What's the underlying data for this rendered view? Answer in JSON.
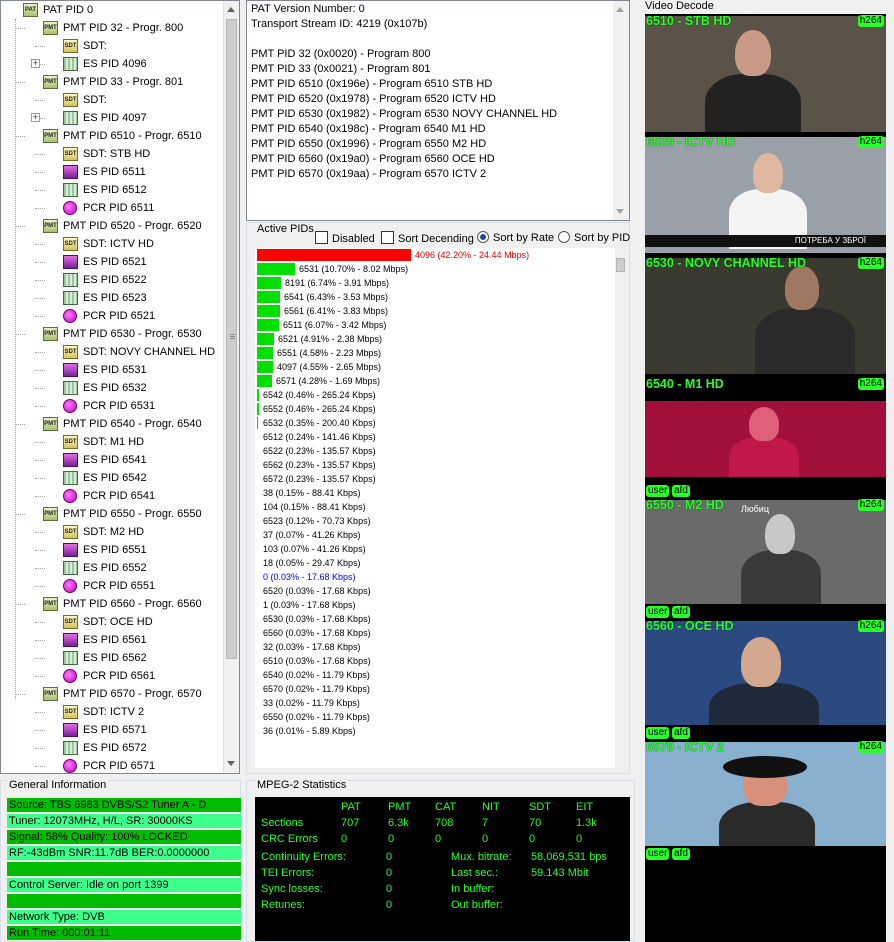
{
  "tree": {
    "rows": [
      {
        "icon": "pat",
        "label": "PAT PID 0",
        "level": 0,
        "expander": ""
      },
      {
        "icon": "pmt",
        "label": "PMT PID 32 - Progr. 800",
        "level": 1,
        "expander": ""
      },
      {
        "icon": "sdt",
        "label": "SDT:",
        "level": 2,
        "expander": ""
      },
      {
        "icon": "es",
        "label": "ES PID 4096",
        "level": 2,
        "expander": "+"
      },
      {
        "icon": "pmt",
        "label": "PMT PID 33 - Progr. 801",
        "level": 1,
        "expander": ""
      },
      {
        "icon": "sdt",
        "label": "SDT:",
        "level": 2,
        "expander": ""
      },
      {
        "icon": "es",
        "label": "ES PID 4097",
        "level": 2,
        "expander": "+"
      },
      {
        "icon": "pmt",
        "label": "PMT PID 6510 - Progr. 6510",
        "level": 1,
        "expander": ""
      },
      {
        "icon": "sdt",
        "label": "SDT: STB HD",
        "level": 2,
        "expander": ""
      },
      {
        "icon": "vid",
        "label": "ES PID 6511",
        "level": 2,
        "expander": ""
      },
      {
        "icon": "es",
        "label": "ES PID 6512",
        "level": 2,
        "expander": ""
      },
      {
        "icon": "pcr",
        "label": "PCR PID 6511",
        "level": 2,
        "expander": ""
      },
      {
        "icon": "pmt",
        "label": "PMT PID 6520 - Progr. 6520",
        "level": 1,
        "expander": ""
      },
      {
        "icon": "sdt",
        "label": "SDT: ICTV HD",
        "level": 2,
        "expander": ""
      },
      {
        "icon": "vid",
        "label": "ES PID 6521",
        "level": 2,
        "expander": ""
      },
      {
        "icon": "es",
        "label": "ES PID 6522",
        "level": 2,
        "expander": ""
      },
      {
        "icon": "es",
        "label": "ES PID 6523",
        "level": 2,
        "expander": ""
      },
      {
        "icon": "pcr",
        "label": "PCR PID 6521",
        "level": 2,
        "expander": ""
      },
      {
        "icon": "pmt",
        "label": "PMT PID 6530 - Progr. 6530",
        "level": 1,
        "expander": ""
      },
      {
        "icon": "sdt",
        "label": "SDT: NOVY CHANNEL HD",
        "level": 2,
        "expander": ""
      },
      {
        "icon": "vid",
        "label": "ES PID 6531",
        "level": 2,
        "expander": ""
      },
      {
        "icon": "es",
        "label": "ES PID 6532",
        "level": 2,
        "expander": ""
      },
      {
        "icon": "pcr",
        "label": "PCR PID 6531",
        "level": 2,
        "expander": ""
      },
      {
        "icon": "pmt",
        "label": "PMT PID 6540 - Progr. 6540",
        "level": 1,
        "expander": ""
      },
      {
        "icon": "sdt",
        "label": "SDT: M1 HD",
        "level": 2,
        "expander": ""
      },
      {
        "icon": "vid",
        "label": "ES PID 6541",
        "level": 2,
        "expander": ""
      },
      {
        "icon": "es",
        "label": "ES PID 6542",
        "level": 2,
        "expander": ""
      },
      {
        "icon": "pcr",
        "label": "PCR PID 6541",
        "level": 2,
        "expander": ""
      },
      {
        "icon": "pmt",
        "label": "PMT PID 6550 - Progr. 6550",
        "level": 1,
        "expander": ""
      },
      {
        "icon": "sdt",
        "label": "SDT: M2 HD",
        "level": 2,
        "expander": ""
      },
      {
        "icon": "vid",
        "label": "ES PID 6551",
        "level": 2,
        "expander": ""
      },
      {
        "icon": "es",
        "label": "ES PID 6552",
        "level": 2,
        "expander": ""
      },
      {
        "icon": "pcr",
        "label": "PCR PID 6551",
        "level": 2,
        "expander": ""
      },
      {
        "icon": "pmt",
        "label": "PMT PID 6560 - Progr. 6560",
        "level": 1,
        "expander": ""
      },
      {
        "icon": "sdt",
        "label": "SDT: OCE HD",
        "level": 2,
        "expander": ""
      },
      {
        "icon": "vid",
        "label": "ES PID 6561",
        "level": 2,
        "expander": ""
      },
      {
        "icon": "es",
        "label": "ES PID 6562",
        "level": 2,
        "expander": ""
      },
      {
        "icon": "pcr",
        "label": "PCR PID 6561",
        "level": 2,
        "expander": ""
      },
      {
        "icon": "pmt",
        "label": "PMT PID 6570 - Progr. 6570",
        "level": 1,
        "expander": ""
      },
      {
        "icon": "sdt",
        "label": "SDT: ICTV 2",
        "level": 2,
        "expander": ""
      },
      {
        "icon": "vid",
        "label": "ES PID 6571",
        "level": 2,
        "expander": ""
      },
      {
        "icon": "es",
        "label": "ES PID 6572",
        "level": 2,
        "expander": ""
      },
      {
        "icon": "pcr",
        "label": "PCR PID 6571",
        "level": 2,
        "expander": ""
      }
    ]
  },
  "info": {
    "lines": [
      "PAT Version Number: 0",
      "Transport Stream ID: 4219 (0x107b)",
      "",
      "PMT PID 32 (0x0020) - Program 800",
      "PMT PID 33 (0x0021) - Program 801",
      "PMT PID 6510 (0x196e) - Program 6510 STB HD",
      "PMT PID 6520 (0x1978) - Program 6520 ICTV HD",
      "PMT PID 6530 (0x1982) - Program 6530 NOVY CHANNEL HD",
      "PMT PID 6540 (0x198c) - Program 6540 M1 HD",
      "PMT PID 6550 (0x1996) - Program 6550 M2 HD",
      "PMT PID 6560 (0x19a0) - Program 6560 OCE HD",
      "PMT PID 6570 (0x19aa) - Program 6570 ICTV 2"
    ]
  },
  "active_pids": {
    "legend": "Active PIDs",
    "options": {
      "disabled": {
        "label": "Disabled",
        "checked": false
      },
      "sort_desc": {
        "label": "Sort Decending",
        "checked": false
      },
      "sort_rate": {
        "label": "Sort by Rate",
        "selected": true
      },
      "sort_pid": {
        "label": "Sort by PID",
        "selected": false
      }
    },
    "rows": [
      {
        "text": "4096 (42.20% - 24.44 Mbps)",
        "pct": 42.2,
        "color": "red"
      },
      {
        "text": "6531 (10.70% - 8.02 Mbps)",
        "pct": 10.7,
        "color": "green"
      },
      {
        "text": "8191 (6.74% - 3.91 Mbps)",
        "pct": 6.74,
        "color": "green"
      },
      {
        "text": "6541 (6.43% - 3.53 Mbps)",
        "pct": 6.43,
        "color": "green"
      },
      {
        "text": "6561 (6.41% - 3.83 Mbps)",
        "pct": 6.41,
        "color": "green"
      },
      {
        "text": "6511 (6.07% - 3.42 Mbps)",
        "pct": 6.07,
        "color": "green"
      },
      {
        "text": "6521 (4.91% - 2.38 Mbps)",
        "pct": 4.91,
        "color": "green"
      },
      {
        "text": "6551 (4.58% - 2.23 Mbps)",
        "pct": 4.58,
        "color": "green"
      },
      {
        "text": "4097 (4.55% - 2.65 Mbps)",
        "pct": 4.55,
        "color": "green"
      },
      {
        "text": "6571 (4.28% - 1.69 Mbps)",
        "pct": 4.28,
        "color": "green"
      },
      {
        "text": "6542 (0.46% - 265.24 Kbps)",
        "pct": 0.46,
        "color": "green"
      },
      {
        "text": "6552 (0.46% - 265.24 Kbps)",
        "pct": 0.46,
        "color": "green"
      },
      {
        "text": "6532 (0.35% - 200.40 Kbps)",
        "pct": 0.35,
        "color": "green"
      },
      {
        "text": "6512 (0.24% - 141.46 Kbps)",
        "pct": 0.24,
        "color": "none"
      },
      {
        "text": "6522 (0.23% - 135.57 Kbps)",
        "pct": 0.23,
        "color": "none"
      },
      {
        "text": "6562 (0.23% - 135.57 Kbps)",
        "pct": 0.23,
        "color": "none"
      },
      {
        "text": "6572 (0.23% - 135.57 Kbps)",
        "pct": 0.23,
        "color": "none"
      },
      {
        "text": "38 (0.15% - 88.41 Kbps)",
        "pct": 0.15,
        "color": "none"
      },
      {
        "text": "104 (0.15% - 88.41 Kbps)",
        "pct": 0.15,
        "color": "none"
      },
      {
        "text": "6523 (0.12% - 70.73 Kbps)",
        "pct": 0.12,
        "color": "none"
      },
      {
        "text": "37 (0.07% - 41.26 Kbps)",
        "pct": 0.07,
        "color": "none"
      },
      {
        "text": "103 (0.07% - 41.26 Kbps)",
        "pct": 0.07,
        "color": "none"
      },
      {
        "text": "18 (0.05% - 29.47 Kbps)",
        "pct": 0.05,
        "color": "none"
      },
      {
        "text": "0 (0.03% - 17.68 Kbps)",
        "pct": 0.03,
        "color": "blue"
      },
      {
        "text": "6520 (0.03% - 17.68 Kbps)",
        "pct": 0.03,
        "color": "none"
      },
      {
        "text": "1 (0.03% - 17.68 Kbps)",
        "pct": 0.03,
        "color": "none"
      },
      {
        "text": "6530 (0.03% - 17.68 Kbps)",
        "pct": 0.03,
        "color": "none"
      },
      {
        "text": "6560 (0.03% - 17.68 Kbps)",
        "pct": 0.03,
        "color": "none"
      },
      {
        "text": "32 (0.03% - 17.68 Kbps)",
        "pct": 0.03,
        "color": "none"
      },
      {
        "text": "6510 (0.03% - 17.68 Kbps)",
        "pct": 0.03,
        "color": "none"
      },
      {
        "text": "6540 (0.02% - 11.79 Kbps)",
        "pct": 0.02,
        "color": "none"
      },
      {
        "text": "6570 (0.02% - 11.79 Kbps)",
        "pct": 0.02,
        "color": "none"
      },
      {
        "text": "33 (0.02% - 11.79 Kbps)",
        "pct": 0.02,
        "color": "none"
      },
      {
        "text": "6550 (0.02% - 11.79 Kbps)",
        "pct": 0.02,
        "color": "none"
      },
      {
        "text": "36 (0.01% - 5.89 Kbps)",
        "pct": 0.01,
        "color": "none"
      }
    ]
  },
  "general": {
    "legend": "General Information",
    "rows": [
      {
        "text": "Source: TBS 6983 DVBS/S2 Tuner A - D",
        "shade": "dark"
      },
      {
        "text": "Tuner: 12073MHz, H/L, SR: 30000KS",
        "shade": "light"
      },
      {
        "text": "Signal: 58% Quality: 100% LOCKED",
        "shade": "dark"
      },
      {
        "text": "RF:-43dBm SNR:11.7dB BER:0.0000000",
        "shade": "light"
      },
      {
        "text": "",
        "shade": "dark"
      },
      {
        "text": "Control Server: Idle on port 1399",
        "shade": "light"
      },
      {
        "text": "",
        "shade": "dark"
      },
      {
        "text": "Network Type: DVB",
        "shade": "light"
      },
      {
        "text": "Run Time: 000:01:11",
        "shade": "dark"
      }
    ]
  },
  "mpeg": {
    "legend": "MPEG-2 Statistics",
    "headers": [
      "PAT",
      "PMT",
      "CAT",
      "NIT",
      "SDT",
      "EIT"
    ],
    "sections_label": "Sections",
    "sections": [
      "707",
      "6.3k",
      "708",
      "7",
      "70",
      "1.3k"
    ],
    "crc_label": "CRC Errors",
    "crc": [
      "0",
      "0",
      "0",
      "0",
      "0",
      "0"
    ],
    "left": [
      {
        "label": "Continuity Errors:",
        "value": "0"
      },
      {
        "label": "TEI Errors:",
        "value": "0"
      },
      {
        "label": "Sync losses:",
        "value": "0"
      },
      {
        "label": "Retunes:",
        "value": "0"
      }
    ],
    "right": [
      {
        "label": "Mux. bitrate:",
        "value": "58,069,531 bps"
      },
      {
        "label": "Last sec.:",
        "value": "59.143 Mbit"
      },
      {
        "label": "In buffer:",
        "value": ""
      },
      {
        "label": "Out buffer:",
        "value": ""
      }
    ]
  },
  "video": {
    "legend": "Video Decode",
    "codec": "h264",
    "tiles": [
      {
        "title": "6510 - STB HD",
        "badges": [],
        "scene": "woman",
        "bg": "#5b5248"
      },
      {
        "title": "6520 - ICTV HD",
        "badges": [],
        "scene": "anchor",
        "bg": "#9aa0a8",
        "ticker": "ПОТРЕБА У ЗБРОЇ"
      },
      {
        "title": "6530 - NOVY CHANNEL HD",
        "badges": [],
        "scene": "man",
        "bg": "#3a3a30"
      },
      {
        "title": "6540 - M1 HD",
        "badges": [
          "user",
          "afd"
        ],
        "scene": "dance",
        "bg": "#a0103a"
      },
      {
        "title": "6550 - M2 HD",
        "badges": [
          "user",
          "afd"
        ],
        "scene": "car",
        "bg": "#6a6a6a",
        "caption": "Любиц"
      },
      {
        "title": "6560 - OCE HD",
        "badges": [
          "user",
          "afd"
        ],
        "scene": "studio",
        "bg": "#2a4a80"
      },
      {
        "title": "6570 - ICTV 2",
        "badges": [
          "user",
          "afd"
        ],
        "scene": "beach",
        "bg": "#8ab0d0"
      }
    ]
  }
}
